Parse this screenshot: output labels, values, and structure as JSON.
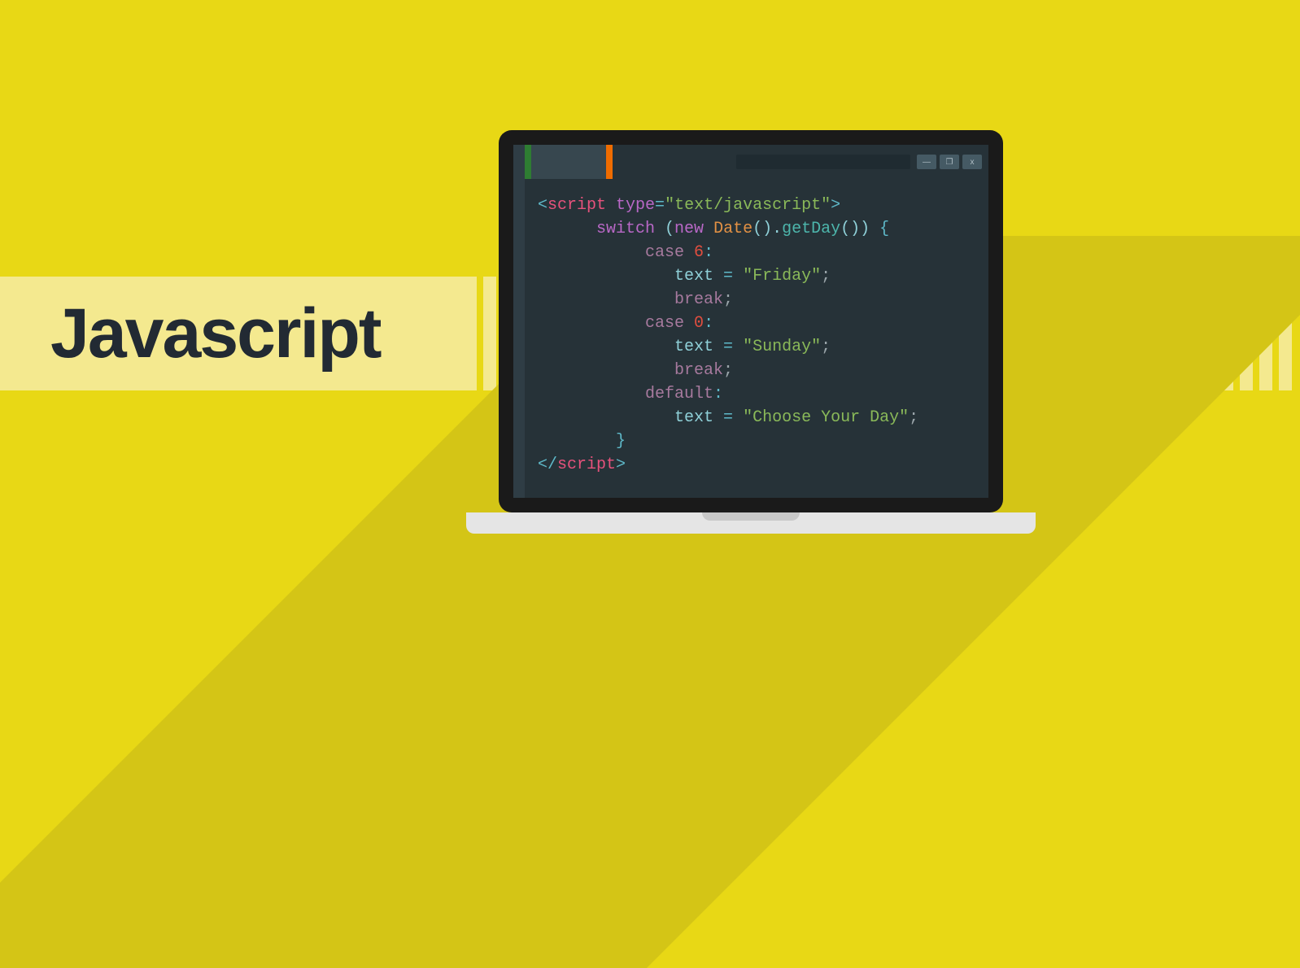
{
  "title": "Javascript",
  "window_controls": {
    "minimize": "—",
    "maximize": "❐",
    "close": "x"
  },
  "code": {
    "open_tag_l": "<",
    "tag_script": "script",
    "attr_type": " type",
    "attr_eq": "=",
    "attr_val": "\"text/javascript\"",
    "open_tag_r": ">",
    "kw_switch": "switch",
    "paren_l": " (",
    "kw_new": "new ",
    "cls_date": "Date",
    "call_date": "()",
    "dot": ".",
    "fn_getday": "getDay",
    "call_getday": "()) ",
    "brace_l": "{",
    "kw_case1": "case ",
    "case1_num": "6",
    "colon": ":",
    "var_text1": "text ",
    "assign": "= ",
    "str_friday": "\"Friday\"",
    "semi": ";",
    "kw_break1": "break",
    "kw_case2": "case ",
    "case2_num": "0",
    "var_text2": "text ",
    "str_sunday": "\"Sunday\"",
    "kw_break2": "break",
    "kw_default": "default",
    "var_text3": "text ",
    "str_choose": "\"Choose Your Day\"",
    "brace_r": "}",
    "close_tag_l": "</",
    "close_tag_r": ">"
  }
}
